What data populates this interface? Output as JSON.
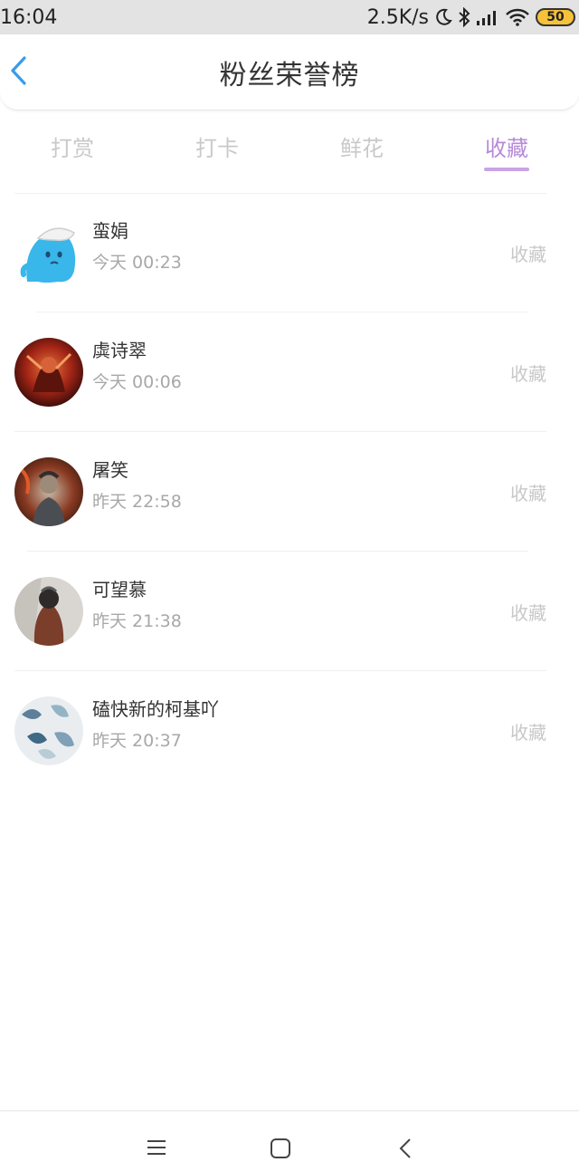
{
  "status_bar": {
    "time": "16:04",
    "net_speed": "2.5K/s",
    "battery": "50",
    "icons": [
      "moon-icon",
      "bluetooth-icon",
      "signal-icon",
      "wifi-icon",
      "battery-icon"
    ]
  },
  "header": {
    "title": "粉丝荣誉榜",
    "back_icon": "chevron-left-icon"
  },
  "tabs": [
    {
      "label": "打赏",
      "active": false
    },
    {
      "label": "打卡",
      "active": false
    },
    {
      "label": "鲜花",
      "active": false
    },
    {
      "label": "收藏",
      "active": true
    }
  ],
  "fans": [
    {
      "name": "蛮娟",
      "time": "今天 00:23",
      "action": "收藏"
    },
    {
      "name": "虡诗翠",
      "time": "今天 00:06",
      "action": "收藏"
    },
    {
      "name": "屠笑",
      "time": "昨天 22:58",
      "action": "收藏"
    },
    {
      "name": "可望慕",
      "time": "昨天 21:38",
      "action": "收藏"
    },
    {
      "name": "磕快新的柯基吖",
      "time": "昨天 20:37",
      "action": "收藏"
    }
  ],
  "nav": [
    "menu-icon",
    "home-icon",
    "back-icon"
  ],
  "colors": {
    "accent": "#b78ad9",
    "back_arrow": "#3a9be8",
    "muted_text": "#a8a8a8"
  }
}
